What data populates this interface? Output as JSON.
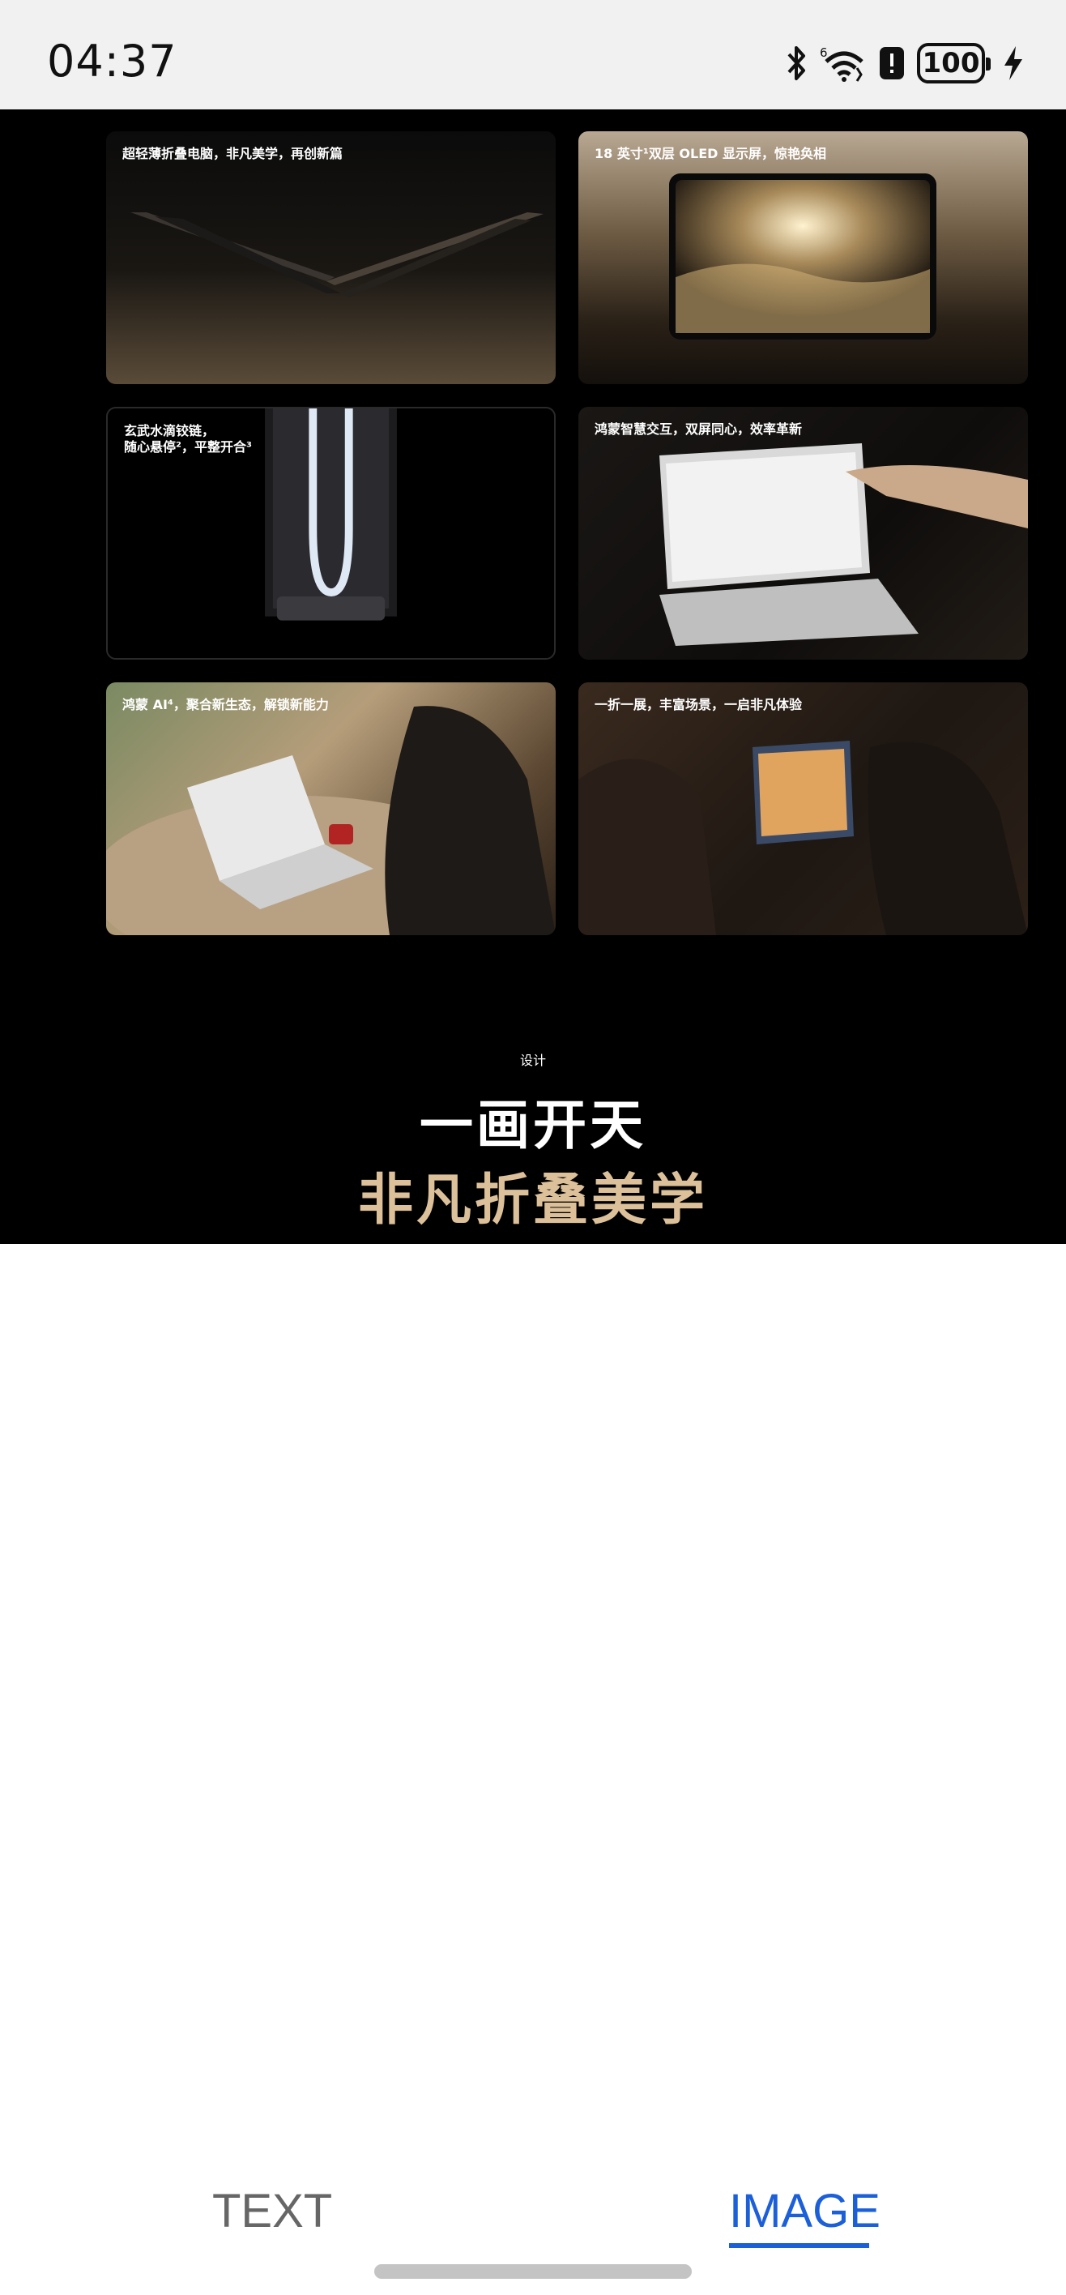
{
  "status_bar": {
    "time": "04:37",
    "battery": "100",
    "icons": [
      "bluetooth-icon",
      "wifi-icon",
      "alert-icon",
      "battery-icon",
      "charging-icon"
    ]
  },
  "cards": [
    {
      "caption": "超轻薄折叠电脑，非凡美学，再创新篇"
    },
    {
      "caption": "18 英寸¹双层 OLED 显示屏，惊艳奂相"
    },
    {
      "caption": "玄武水滴铰链，\n随心悬停²，平整开合³"
    },
    {
      "caption": "鸿蒙智慧交互，双屏同心，效率革新"
    },
    {
      "caption": "鸿蒙 AI⁴，聚合新生态，解锁新能力"
    },
    {
      "caption": "一折一展，丰富场景，一启非凡体验"
    }
  ],
  "section": {
    "label": "设计",
    "headline_1": "一画开天",
    "headline_2": "非凡折叠美学"
  },
  "tabs": {
    "text": "TEXT",
    "image": "IMAGE"
  },
  "colors": {
    "accent_gold": "#dcc09a",
    "tab_active": "#1b5fd9",
    "tab_inactive": "#666666"
  }
}
